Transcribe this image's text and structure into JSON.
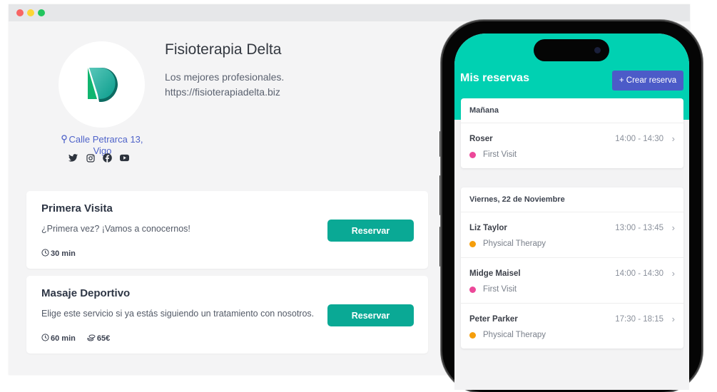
{
  "window": {
    "controls": [
      "close",
      "minimize",
      "maximize"
    ]
  },
  "business": {
    "name": "Fisioterapia Delta",
    "tagline": "Los mejores profesionales.",
    "website": "https://fisioterapiadelta.biz",
    "address": "Calle Petrarca 13, Vigo",
    "logo_colors": {
      "green": "#10b981",
      "teal": "#0fa99a",
      "dark": "#0d6b62"
    },
    "socials": [
      "twitter-icon",
      "instagram-icon",
      "facebook-icon",
      "youtube-icon"
    ]
  },
  "services": [
    {
      "name": "Primera Visita",
      "description": "¿Primera vez? ¡Vamos a conocernos!",
      "duration": "30 min",
      "price": null,
      "button": "Reservar"
    },
    {
      "name": "Masaje Deportivo",
      "description": "Elige este servicio si ya estás siguiendo un tratamiento con nosotros.",
      "duration": "60 min",
      "price": "65€",
      "button": "Reservar"
    }
  ],
  "phone": {
    "title": "Mis reservas",
    "create_button": "+ Crear reserva",
    "colors": {
      "header": "#00d1b2",
      "button": "#4c5bc8",
      "first_visit": "#ec4899",
      "physical_therapy": "#f59e0b"
    },
    "groups": [
      {
        "label": "Mañana",
        "appointments": [
          {
            "name": "Roser",
            "time": "14:00 - 14:30",
            "type": "First Visit",
            "color": "#ec4899"
          }
        ]
      },
      {
        "label": "Viernes, 22 de Noviembre",
        "appointments": [
          {
            "name": "Liz Taylor",
            "time": "13:00 - 13:45",
            "type": "Physical Therapy",
            "color": "#f59e0b"
          },
          {
            "name": "Midge Maisel",
            "time": "14:00 - 14:30",
            "type": "First Visit",
            "color": "#ec4899"
          },
          {
            "name": "Peter Parker",
            "time": "17:30 - 18:15",
            "type": "Physical Therapy",
            "color": "#f59e0b"
          }
        ]
      }
    ]
  }
}
